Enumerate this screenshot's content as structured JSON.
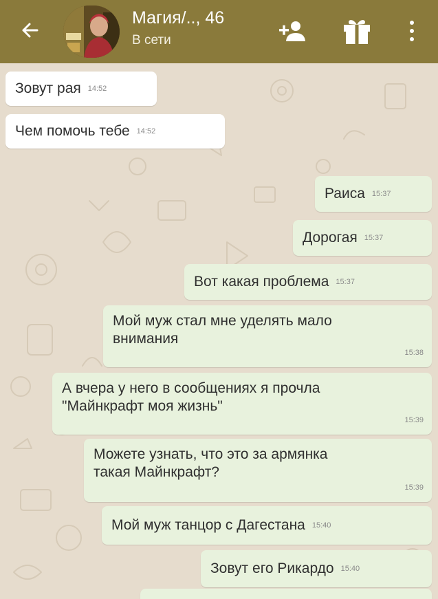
{
  "header": {
    "contact_name": "Магия/.., 46",
    "status": "В сети",
    "icons": {
      "back": "arrow-left-icon",
      "add_contact": "person-add-icon",
      "gift": "gift-icon",
      "menu": "more-vert-icon"
    },
    "colors": {
      "bar": "#8a7a3b",
      "incoming_bubble": "#ffffff",
      "outgoing_bubble": "#e8f2dd",
      "wallpaper": "#e6dccd"
    }
  },
  "messages": [
    {
      "direction": "in",
      "text": "Зовут рая",
      "time": "14:52"
    },
    {
      "direction": "in",
      "text": "Чем помочь тебе",
      "time": "14:52"
    },
    {
      "direction": "out",
      "text": "Раиса",
      "time": "15:37"
    },
    {
      "direction": "out",
      "text": "Дорогая",
      "time": "15:37"
    },
    {
      "direction": "out",
      "text": "Вот какая проблема",
      "time": "15:37"
    },
    {
      "direction": "out",
      "text": "Мой муж стал мне уделять мало\nвнимания",
      "time": "15:38"
    },
    {
      "direction": "out",
      "text": "А вчера у него в сообщениях я прочла\n\"Майнкрафт моя жизнь\"",
      "time": "15:39"
    },
    {
      "direction": "out",
      "text": "Можете узнать, что это за армянка\nтакая Майнкрафт?",
      "time": "15:39"
    },
    {
      "direction": "out",
      "text": "Мой муж танцор с Дагестана",
      "time": "15:40"
    },
    {
      "direction": "out",
      "text": "Зовут его Рикардо",
      "time": "15:40"
    }
  ]
}
